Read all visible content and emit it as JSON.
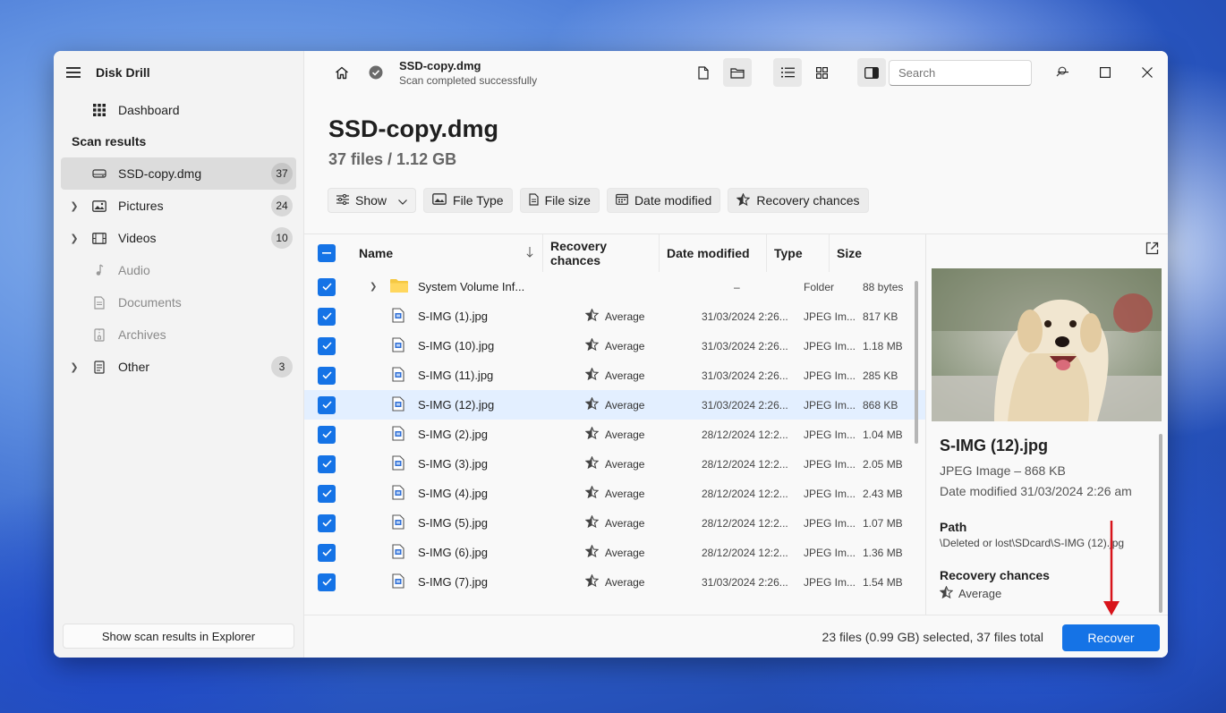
{
  "app": {
    "title": "Disk Drill"
  },
  "sidebar": {
    "dashboard_label": "Dashboard",
    "section_label": "Scan results",
    "items": [
      {
        "label": "SSD-copy.dmg",
        "count": "37",
        "icon": "drive-icon",
        "active": true
      },
      {
        "label": "Pictures",
        "count": "24",
        "icon": "image-icon"
      },
      {
        "label": "Videos",
        "count": "10",
        "icon": "film-icon"
      },
      {
        "label": "Audio",
        "icon": "music-icon"
      },
      {
        "label": "Documents",
        "icon": "document-icon"
      },
      {
        "label": "Archives",
        "icon": "archive-icon"
      },
      {
        "label": "Other",
        "count": "3",
        "icon": "other-file-icon"
      }
    ],
    "footer_button": "Show scan results in Explorer"
  },
  "topbar": {
    "title": "SSD-copy.dmg",
    "subtitle": "Scan completed successfully",
    "search_placeholder": "Search"
  },
  "heading": {
    "title": "SSD-copy.dmg",
    "subtitle": "37 files / 1.12 GB"
  },
  "filters": {
    "show": "Show",
    "file_type": "File Type",
    "file_size": "File size",
    "date_modified": "Date modified",
    "recovery_chances": "Recovery chances"
  },
  "table": {
    "columns": {
      "name": "Name",
      "recovery": "Recovery chances",
      "date": "Date modified",
      "type": "Type",
      "size": "Size"
    },
    "rows": [
      {
        "name": "System Volume Inf...",
        "recovery": "",
        "date": "–",
        "type": "Folder",
        "size": "88 bytes",
        "folder": true
      },
      {
        "name": "S-IMG (1).jpg",
        "recovery": "Average",
        "date": "31/03/2024 2:26...",
        "type": "JPEG Im...",
        "size": "817 KB"
      },
      {
        "name": "S-IMG (10).jpg",
        "recovery": "Average",
        "date": "31/03/2024 2:26...",
        "type": "JPEG Im...",
        "size": "1.18 MB"
      },
      {
        "name": "S-IMG (11).jpg",
        "recovery": "Average",
        "date": "31/03/2024 2:26...",
        "type": "JPEG Im...",
        "size": "285 KB"
      },
      {
        "name": "S-IMG (12).jpg",
        "recovery": "Average",
        "date": "31/03/2024 2:26...",
        "type": "JPEG Im...",
        "size": "868 KB",
        "selected": true
      },
      {
        "name": "S-IMG (2).jpg",
        "recovery": "Average",
        "date": "28/12/2024 12:2...",
        "type": "JPEG Im...",
        "size": "1.04 MB"
      },
      {
        "name": "S-IMG (3).jpg",
        "recovery": "Average",
        "date": "28/12/2024 12:2...",
        "type": "JPEG Im...",
        "size": "2.05 MB"
      },
      {
        "name": "S-IMG (4).jpg",
        "recovery": "Average",
        "date": "28/12/2024 12:2...",
        "type": "JPEG Im...",
        "size": "2.43 MB"
      },
      {
        "name": "S-IMG (5).jpg",
        "recovery": "Average",
        "date": "28/12/2024 12:2...",
        "type": "JPEG Im...",
        "size": "1.07 MB"
      },
      {
        "name": "S-IMG (6).jpg",
        "recovery": "Average",
        "date": "28/12/2024 12:2...",
        "type": "JPEG Im...",
        "size": "1.36 MB"
      },
      {
        "name": "S-IMG (7).jpg",
        "recovery": "Average",
        "date": "31/03/2024 2:26...",
        "type": "JPEG Im...",
        "size": "1.54 MB"
      }
    ]
  },
  "preview": {
    "title": "S-IMG (12).jpg",
    "meta": "JPEG Image – 868 KB",
    "date": "Date modified 31/03/2024 2:26 am",
    "path_label": "Path",
    "path": "\\Deleted or lost\\SDcard\\S-IMG (12).jpg",
    "recovery_label": "Recovery chances",
    "recovery_value": "Average"
  },
  "footer": {
    "summary": "23 files (0.99 GB) selected, 37 files total",
    "recover_label": "Recover"
  },
  "colors": {
    "accent": "#1573e6",
    "annotation_arrow": "#d8141b"
  }
}
